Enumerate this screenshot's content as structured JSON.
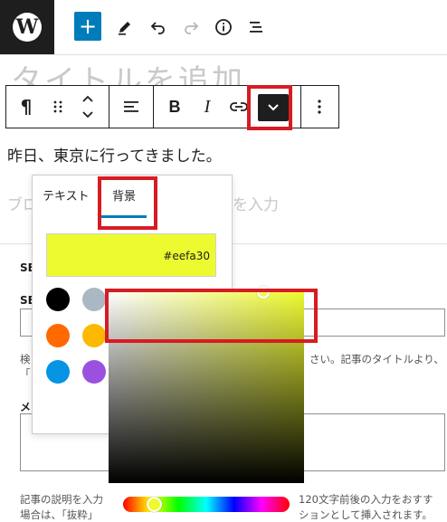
{
  "post": {
    "title_placeholder": "タイトルを追加",
    "paragraph": "昨日、東京に行ってきました。",
    "ghost_left": "ブロ",
    "ghost_right": "を入力"
  },
  "block_toolbar": {
    "paragraph_glyph": "¶",
    "bold_label": "B",
    "italic_label": "I"
  },
  "color_popover": {
    "tabs": [
      {
        "label": "テキスト",
        "active": false
      },
      {
        "label": "背景",
        "active": true
      }
    ],
    "current_color": "#eefa30",
    "swatches": [
      "#000000",
      "#abb8c3",
      "#ff6900",
      "#fcb900",
      "#0693e3",
      "#9b51e0"
    ]
  },
  "settings_panel": {
    "section_a_label": "SE",
    "section_b_label": "SE",
    "section_c_label": "メ",
    "help_line1_left": "検",
    "help_line1_right": "さい。記事のタイトルより、",
    "help_line2_left": "「",
    "help_line3_left": "記事の説明を入力",
    "help_line3_right": "120文字前後の入力をおすす",
    "help_line4_left": "場合は、「抜粋」",
    "help_line4_right": "ションとして挿入されます。"
  },
  "annotation_color": "#d71c23",
  "accent_color": "#007cba"
}
